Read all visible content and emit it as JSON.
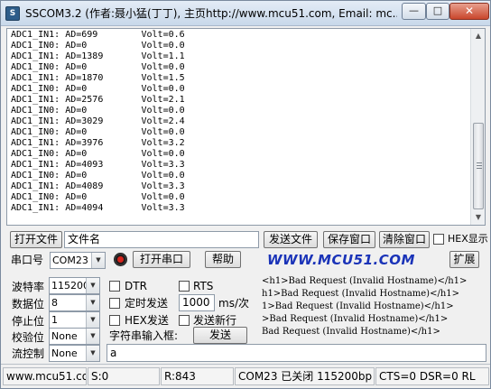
{
  "window": {
    "title": "SSCOM3.2 (作者:聂小猛(丁丁), 主页http://www.mcu51.com,  Email: mc...",
    "icon": "app-icon",
    "icon_glyph": "S",
    "minimize_glyph": "—",
    "maximize_glyph": "□",
    "close_glyph": "✕"
  },
  "receive": {
    "lines": [
      "ADC1_IN1: AD=699        Volt=0.6",
      "ADC1_IN0: AD=0          Volt=0.0",
      "ADC1_IN1: AD=1389       Volt=1.1",
      "ADC1_IN0: AD=0          Volt=0.0",
      "ADC1_IN1: AD=1870       Volt=1.5",
      "ADC1_IN0: AD=0          Volt=0.0",
      "ADC1_IN1: AD=2576       Volt=2.1",
      "ADC1_IN0: AD=0          Volt=0.0",
      "ADC1_IN1: AD=3029       Volt=2.4",
      "ADC1_IN0: AD=0          Volt=0.0",
      "ADC1_IN1: AD=3976       Volt=3.2",
      "ADC1_IN0: AD=0          Volt=0.0",
      "ADC1_IN1: AD=4093       Volt=3.3",
      "ADC1_IN0: AD=0          Volt=0.0",
      "ADC1_IN1: AD=4089       Volt=3.3",
      "ADC1_IN0: AD=0          Volt=0.0",
      "ADC1_IN1: AD=4094       Volt=3.3"
    ],
    "scroll_up_glyph": "▲",
    "scroll_down_glyph": "▼"
  },
  "file_row": {
    "open_file_button": "打开文件",
    "filename_value": "文件名",
    "send_file_button": "发送文件",
    "save_window_button": "保存窗口",
    "clear_window_button": "清除窗口",
    "hex_display_label": "HEX显示"
  },
  "port_row": {
    "port_label": "串口号",
    "port_value": "COM23",
    "open_port_button": "打开串口",
    "help_button": "帮助",
    "brand_text": "WWW.MCU51.COM",
    "expand_button": "扩展",
    "indicator_color": "#d8241c"
  },
  "settings": {
    "baud_label": "波特率",
    "baud_value": "115200",
    "data_bits_label": "数据位",
    "data_bits_value": "8",
    "stop_bits_label": "停止位",
    "stop_bits_value": "1",
    "parity_label": "校验位",
    "parity_value": "None",
    "flow_label": "流控制",
    "flow_value": "None"
  },
  "options": {
    "dtr_label": "DTR",
    "rts_label": "RTS",
    "timed_send_label": "定时发送",
    "interval_value": "1000",
    "interval_unit": "ms/次",
    "hex_send_label": "HEX发送",
    "send_newline_label": "发送新行",
    "string_input_label": "字符串输入框:",
    "send_button": "发送"
  },
  "bad_request_lines": [
    "<h1>Bad Request (Invalid Hostname)</h1>",
    "h1>Bad Request (Invalid Hostname)</h1>",
    "1>Bad Request (Invalid Hostname)</h1>",
    ">Bad Request (Invalid Hostname)</h1>",
    "Bad Request (Invalid Hostname)</h1>"
  ],
  "send_input_value": "a",
  "status": {
    "website": "www.mcu51.cor",
    "sent": "S:0",
    "received": "R:843",
    "port_state": "COM23 已关闭  115200bp",
    "signals": "CTS=0 DSR=0 RL"
  }
}
